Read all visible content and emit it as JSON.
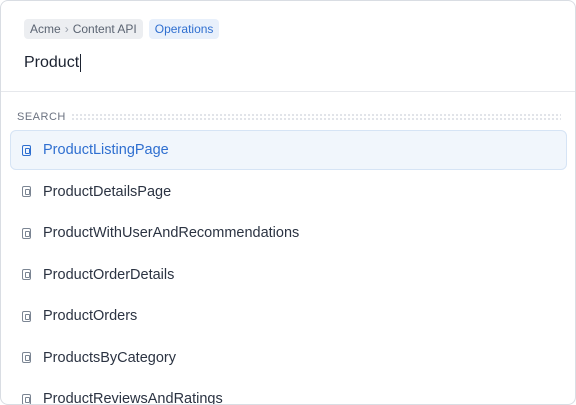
{
  "breadcrumb": {
    "segments": [
      "Acme",
      "Content API"
    ],
    "separator": "›",
    "tag": "Operations"
  },
  "search": {
    "query": "Product"
  },
  "results": {
    "section_label": "SEARCH",
    "items": [
      {
        "label": "ProductListingPage",
        "icon": "operation-icon",
        "selected": true
      },
      {
        "label": "ProductDetailsPage",
        "icon": "operation-icon",
        "selected": false
      },
      {
        "label": "ProductWithUserAndRecommendations",
        "icon": "operation-icon",
        "selected": false
      },
      {
        "label": "ProductOrderDetails",
        "icon": "operation-icon",
        "selected": false
      },
      {
        "label": "ProductOrders",
        "icon": "operation-icon",
        "selected": false
      },
      {
        "label": "ProductsByCategory",
        "icon": "operation-icon",
        "selected": false
      },
      {
        "label": "ProductReviewsAndRatings",
        "icon": "operation-icon",
        "selected": false
      }
    ]
  },
  "colors": {
    "accent": "#2f6fd0",
    "selected_bg": "#f1f6fc"
  }
}
